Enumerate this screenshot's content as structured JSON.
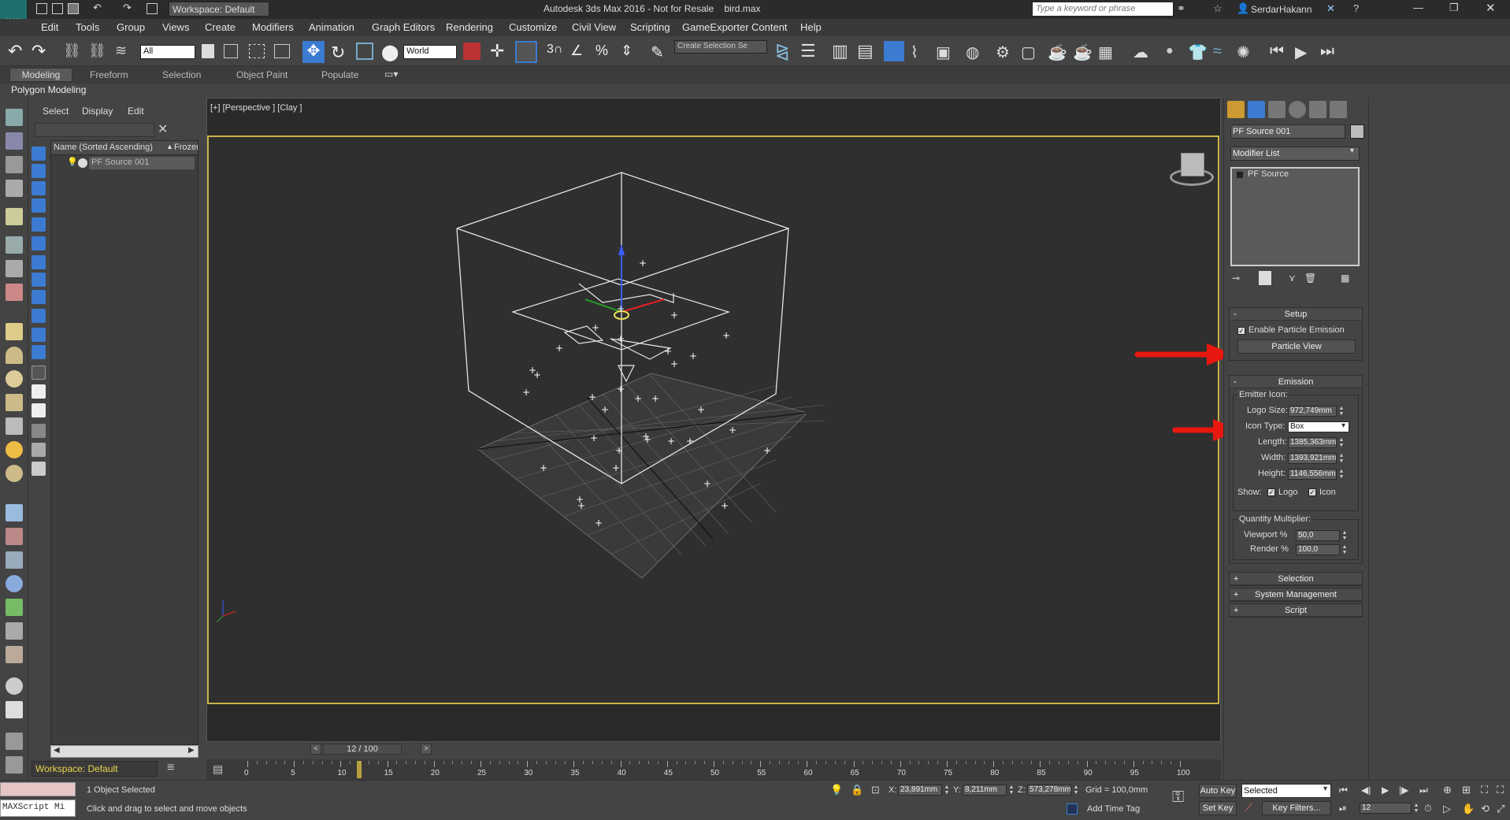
{
  "app": {
    "title": "Autodesk 3ds Max 2016 - Not for Resale    bird.max",
    "logo": "MAX",
    "workspace": "Workspace: Default",
    "search_placeholder": "Type a keyword or phrase",
    "user": "SerdarHakann"
  },
  "menu": [
    "Edit",
    "Tools",
    "Group",
    "Views",
    "Create",
    "Modifiers",
    "Animation",
    "Graph Editors",
    "Rendering",
    "Customize",
    "Civil View",
    "Scripting",
    "GameExporter",
    "Content",
    "Help"
  ],
  "toolbar": {
    "selection_filter": "All",
    "reference_coord": "World",
    "named_selection": "Create Selection Se"
  },
  "ribbon": {
    "tabs": [
      "Modeling",
      "Freeform",
      "Selection",
      "Object Paint",
      "Populate"
    ],
    "active_tab": "Modeling",
    "sub_label": "Polygon Modeling"
  },
  "scene_explorer": {
    "tabs": [
      "Select",
      "Display",
      "Edit"
    ],
    "col_name": "Name (Sorted Ascending)",
    "col_frozen": "Frozen",
    "rows": [
      "PF Source 001"
    ],
    "workspace": "Workspace: Default"
  },
  "viewport": {
    "label": "[+] [Perspective ] [Clay ]"
  },
  "command_panel": {
    "object_name": "PF Source 001",
    "modifier_list": "Modifier List",
    "stack_item": "PF Source",
    "setup": {
      "title": "Setup",
      "enable_label": "Enable Particle Emission",
      "particle_view": "Particle View"
    },
    "emission": {
      "title": "Emission",
      "emitter_icon": "Emitter Icon:",
      "logo_size_label": "Logo Size:",
      "logo_size": "972,749mm",
      "icon_type_label": "Icon Type:",
      "icon_type": "Box",
      "length_label": "Length:",
      "length": "1385,363mm",
      "width_label": "Width:",
      "width": "1393,921mm",
      "height_label": "Height:",
      "height": "1146,556mm",
      "show_label": "Show:",
      "show_logo": "Logo",
      "show_icon": "Icon",
      "quantity_label": "Quantity Multiplier:",
      "viewport_label": "Viewport %",
      "viewport_val": "50,0",
      "render_label": "Render %",
      "render_val": "100,0"
    },
    "collapsed": [
      "Selection",
      "System Management",
      "Script"
    ]
  },
  "timeline": {
    "frame": "12 / 100",
    "current_frame": 12,
    "max_frame": 100,
    "ticks": [
      "0",
      "5",
      "10",
      "15",
      "20",
      "25",
      "30",
      "35",
      "40",
      "45",
      "50",
      "55",
      "60",
      "65",
      "70",
      "75",
      "80",
      "85",
      "90",
      "95",
      "100"
    ]
  },
  "status": {
    "maxscript": "MAXScript Mi",
    "selected": "1 Object Selected",
    "prompt": "Click and drag to select and move objects",
    "x_label": "X:",
    "x": "23,891mm",
    "y_label": "Y:",
    "y": "8,211mm",
    "z_label": "Z:",
    "z": "573,278mm",
    "grid": "Grid = 100,0mm",
    "add_time_tag": "Add Time Tag",
    "auto_key": "Auto Key",
    "set_key": "Set Key",
    "selected_mode": "Selected",
    "key_filters": "Key Filters...",
    "frame_field": "12"
  },
  "colors": {
    "viewport_border": "#c8b34b",
    "arrow": "#e8170f",
    "active_btn": "#3c7bd2"
  }
}
